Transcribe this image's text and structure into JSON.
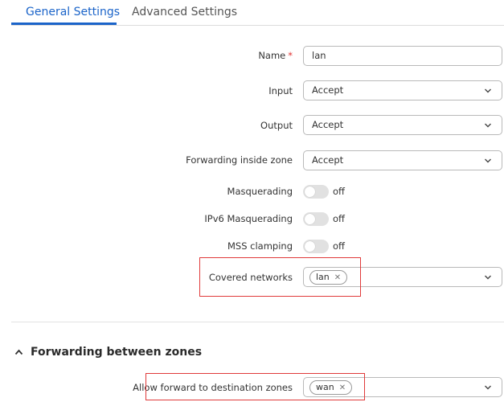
{
  "tabs": [
    {
      "label": "General Settings",
      "active": true
    },
    {
      "label": "Advanced Settings",
      "active": false
    }
  ],
  "form": {
    "name": {
      "label": "Name",
      "required_mark": "*",
      "value": "lan"
    },
    "input": {
      "label": "Input",
      "value": "Accept"
    },
    "output": {
      "label": "Output",
      "value": "Accept"
    },
    "forwarding_inside_zone": {
      "label": "Forwarding inside zone",
      "value": "Accept"
    },
    "masquerading": {
      "label": "Masquerading",
      "state": "off"
    },
    "ipv6_masquerading": {
      "label": "IPv6 Masquerading",
      "state": "off"
    },
    "mss_clamping": {
      "label": "MSS clamping",
      "state": "off"
    },
    "covered_networks": {
      "label": "Covered networks",
      "chips": [
        "lan"
      ]
    }
  },
  "forwarding_section": {
    "title": "Forwarding between zones",
    "allow_forward": {
      "label": "Allow forward to destination zones",
      "chips": [
        "wan"
      ]
    }
  },
  "colors": {
    "accent": "#1b64c9",
    "highlight": "#e03a3a",
    "required": "#e03030"
  },
  "icons": {
    "select_indicator": "chevron-down-icon",
    "chip_remove": "close-icon",
    "section_toggle": "chevron-up-icon"
  }
}
